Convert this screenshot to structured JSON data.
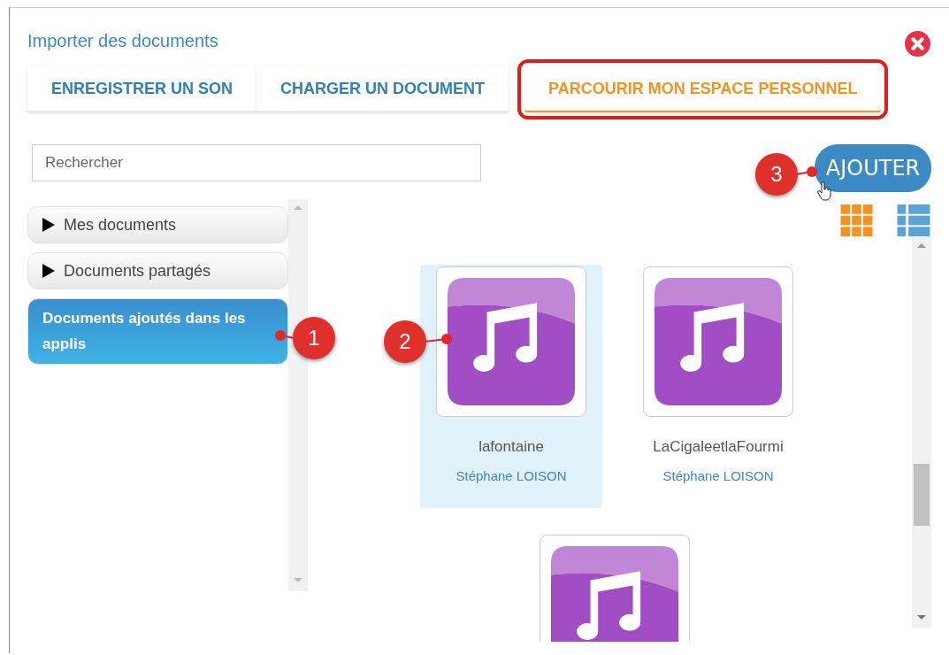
{
  "dialog": {
    "title": "Importer des documents"
  },
  "tabs": [
    {
      "label": "ENREGISTRER UN SON",
      "selected": false,
      "highlighted": false
    },
    {
      "label": "CHARGER UN DOCUMENT",
      "selected": false,
      "highlighted": false
    },
    {
      "label": "PARCOURIR MON ESPACE PERSONNEL",
      "selected": true,
      "highlighted": true
    }
  ],
  "search": {
    "placeholder": "Rechercher"
  },
  "add_button": {
    "label": "AJOUTER"
  },
  "view_modes": [
    {
      "kind": "grid",
      "selected": true
    },
    {
      "kind": "list",
      "selected": false
    }
  ],
  "folders": [
    {
      "label": "Mes documents",
      "expandable": true,
      "selected": false
    },
    {
      "label": "Documents partagés",
      "expandable": true,
      "selected": false
    },
    {
      "label": "Documents ajoutés dans les applis",
      "expandable": false,
      "selected": true
    }
  ],
  "files": [
    {
      "name": "lafontaine",
      "author": "Stéphane LOISON",
      "selected": true
    },
    {
      "name": "LaCigaleetlaFourmi",
      "author": "Stéphane LOISON",
      "selected": false
    },
    {
      "selected": false
    }
  ],
  "callouts": [
    {
      "label": "1"
    },
    {
      "label": "2"
    },
    {
      "label": "3"
    }
  ]
}
